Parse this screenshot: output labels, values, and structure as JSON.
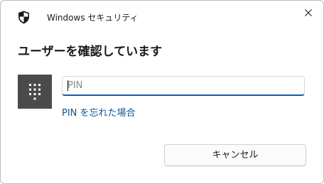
{
  "window": {
    "title": "Windows セキュリティ",
    "close_icon": "close-icon",
    "app_icon": "shield-icon"
  },
  "dialog": {
    "heading": "ユーザーを確認しています",
    "keypad_icon": "keypad-icon",
    "pin_input": {
      "value": "",
      "placeholder": "PIN"
    },
    "forgot_pin_link": "PIN を忘れた場合",
    "cancel_label": "キャンセル"
  },
  "colors": {
    "accent": "#0a5cc2",
    "link": "#0a5599",
    "tile": "#4a4a4a"
  }
}
